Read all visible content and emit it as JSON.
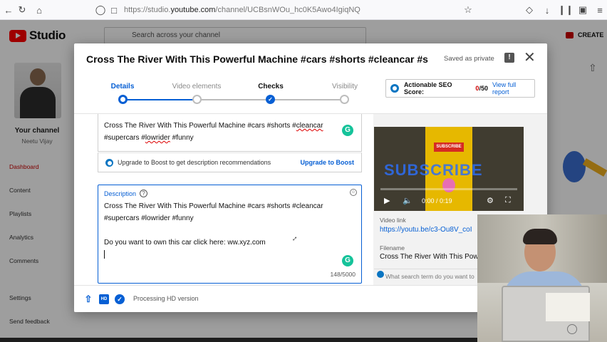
{
  "browser": {
    "url_prefix": "https://studio.",
    "url_domain": "youtube.com",
    "url_rest": "/channel/UCBsnWOu_hc0K5Awo4IgiqNQ"
  },
  "studio": {
    "logo_text": "Studio",
    "search_placeholder": "Search across your channel",
    "create_label": "CREATE",
    "your_channel": "Your channel",
    "channel_name": "Neetu Vijay",
    "sidebar": [
      "Dashboard",
      "Content",
      "Playlists",
      "Analytics",
      "Comments",
      "Settings",
      "Send feedback"
    ]
  },
  "dialog": {
    "title": "Cross The River With This Powerful Machine #cars #shorts #cleancar #su...",
    "saved_status": "Saved as private",
    "steps": [
      {
        "label": "Details",
        "state": "current"
      },
      {
        "label": "Video elements",
        "state": "todo"
      },
      {
        "label": "Checks",
        "state": "done"
      },
      {
        "label": "Visibility",
        "state": "todo"
      }
    ],
    "seo": {
      "label": "Actionable SEO Score:",
      "score": "0",
      "max": "/50",
      "link": "View full report"
    },
    "title_field": {
      "line1_pre": "Cross The River With This Powerful Machine #cars #shorts #",
      "line1_err": "cleancar",
      "line2_pre": "#supercars #",
      "line2_err": "lowrider",
      "line2_post": " #funny"
    },
    "boost": {
      "text": "Upgrade to Boost to get description recommendations",
      "link": "Upgrade to Boost"
    },
    "description": {
      "label": "Description",
      "text": "Cross The River With This Powerful Machine #cars #shorts #cleancar\n#supercars #lowrider #funny\n\nDo you want to own this car click here: ww.xyz.com",
      "char_count": "148/5000"
    },
    "video": {
      "subscribe_text": "SUBSCRIBE",
      "overlay_word": "SUBSCRIBE",
      "time": "0:00 / 0:19",
      "progress": 0.0
    },
    "video_link_label": "Video link",
    "video_link": "https://youtu.be/c3-Ou8V_coI",
    "filename_label": "Filename",
    "filename": "Cross The River With This Powerful",
    "search_term_placeholder": "What search term do you want to",
    "footer": {
      "hd_badge": "HD",
      "processing": "Processing HD version"
    }
  },
  "colors": {
    "accent": "#065fd4",
    "brand_red": "#ff0000",
    "error_red": "#cc0000"
  }
}
